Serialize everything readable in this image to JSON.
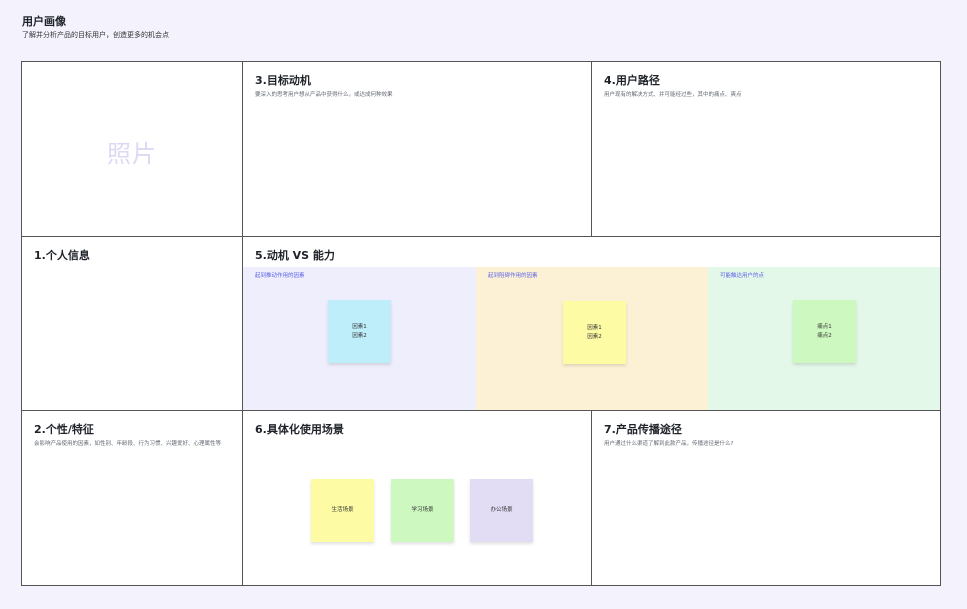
{
  "header": {
    "title": "用户画像",
    "subtitle": "了解并分析产品的目标用户，创造更多的机会点"
  },
  "photo": {
    "label": "照片"
  },
  "sections": {
    "personal_info": {
      "title": "1.个人信息"
    },
    "traits": {
      "title": "2.个性/特征",
      "desc": "会影响产品使用的因素，如性别、年龄段、行为习惯、兴趣爱好、心理属性等"
    },
    "goal_motivation": {
      "title": "3.目标动机",
      "desc": "要深入的思考用户想从产品中获得什么，或达成何种效果"
    },
    "user_path": {
      "title": "4.用户路径",
      "desc": "用户现有的解决方式、并可能经过些，其中的痛点、爽点"
    },
    "motivation_ability": {
      "title": "5.动机 VS 能力",
      "zones": [
        {
          "label": "起到推动作用的因素",
          "notes": [
            "因素1",
            "因素2"
          ],
          "bg": "#efeefc",
          "note_color": "#bdeefa"
        },
        {
          "label": "起到阻碍作用的因素",
          "notes": [
            "因素1",
            "因素2"
          ],
          "bg": "#fdf1d5",
          "note_color": "#fdfba3"
        },
        {
          "label": "可能触达用户的点",
          "notes": [
            "痛点1",
            "痛点2"
          ],
          "bg": "#e4f8ea",
          "note_color": "#cdf9c0"
        }
      ]
    },
    "scenarios": {
      "title": "6.具体化使用场景",
      "notes": [
        {
          "label": "生活场景",
          "color": "#fdfba3"
        },
        {
          "label": "学习场景",
          "color": "#cdf9c0"
        },
        {
          "label": "办公场景",
          "color": "#e3dcf5"
        }
      ]
    },
    "propagation": {
      "title": "7.产品传播途径",
      "desc": "用户通过什么渠道了解到此款产品，传播途径是什么?"
    }
  }
}
